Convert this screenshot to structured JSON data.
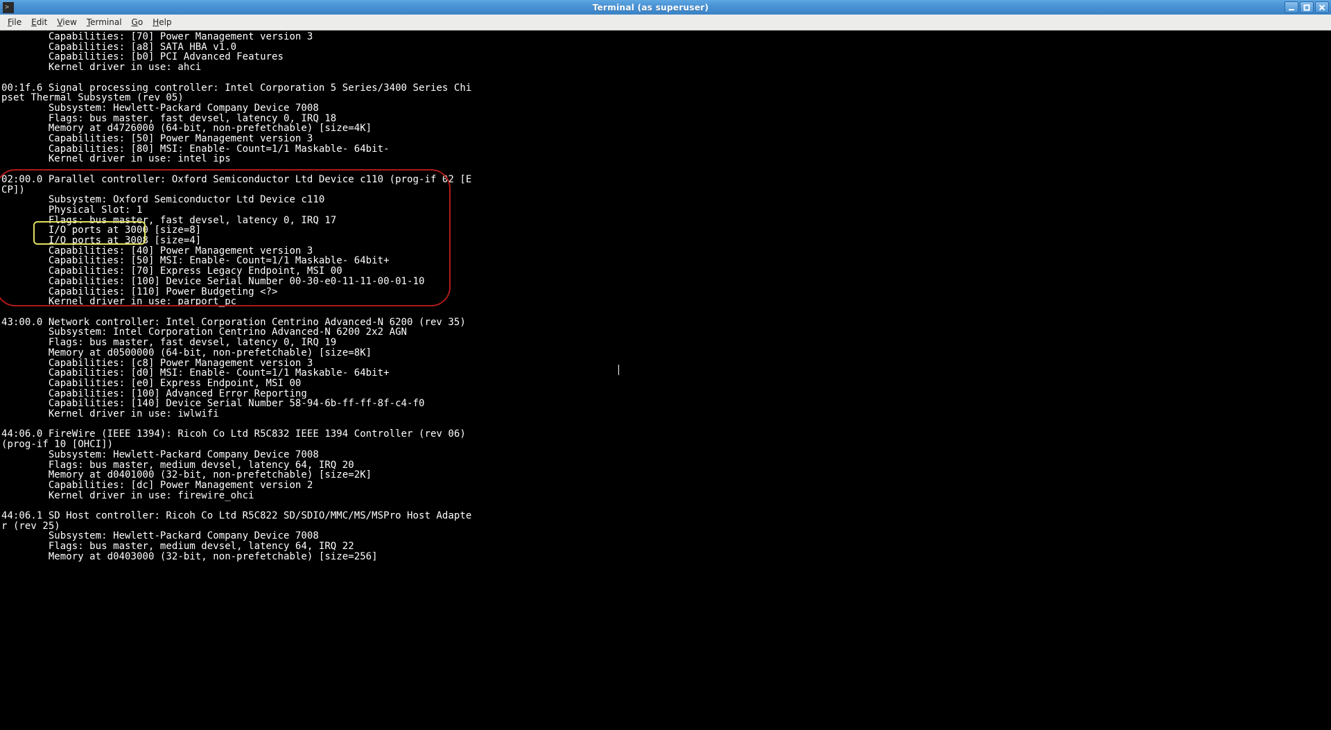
{
  "window": {
    "title": "Terminal (as superuser)"
  },
  "menu": {
    "file": "File",
    "edit": "Edit",
    "view": "View",
    "terminal": "Terminal",
    "go": "Go",
    "help": "Help"
  },
  "terminal": {
    "lines": [
      "        Capabilities: [70] Power Management version 3",
      "        Capabilities: [a8] SATA HBA v1.0",
      "        Capabilities: [b0] PCI Advanced Features",
      "        Kernel driver in use: ahci",
      "",
      "00:1f.6 Signal processing controller: Intel Corporation 5 Series/3400 Series Chi",
      "pset Thermal Subsystem (rev 05)",
      "        Subsystem: Hewlett-Packard Company Device 7008",
      "        Flags: bus master, fast devsel, latency 0, IRQ 18",
      "        Memory at d4726000 (64-bit, non-prefetchable) [size=4K]",
      "        Capabilities: [50] Power Management version 3",
      "        Capabilities: [80] MSI: Enable- Count=1/1 Maskable- 64bit-",
      "        Kernel driver in use: intel ips",
      "",
      "02:00.0 Parallel controller: Oxford Semiconductor Ltd Device c110 (prog-if 02 [E",
      "CP])",
      "        Subsystem: Oxford Semiconductor Ltd Device c110",
      "        Physical Slot: 1",
      "        Flags: bus master, fast devsel, latency 0, IRQ 17",
      "        I/O ports at 3000 [size=8]",
      "        I/O ports at 3008 [size=4]",
      "        Capabilities: [40] Power Management version 3",
      "        Capabilities: [50] MSI: Enable- Count=1/1 Maskable- 64bit+",
      "        Capabilities: [70] Express Legacy Endpoint, MSI 00",
      "        Capabilities: [100] Device Serial Number 00-30-e0-11-11-00-01-10",
      "        Capabilities: [110] Power Budgeting <?>",
      "        Kernel driver in use: parport_pc",
      "",
      "43:00.0 Network controller: Intel Corporation Centrino Advanced-N 6200 (rev 35)",
      "        Subsystem: Intel Corporation Centrino Advanced-N 6200 2x2 AGN",
      "        Flags: bus master, fast devsel, latency 0, IRQ 19",
      "        Memory at d0500000 (64-bit, non-prefetchable) [size=8K]",
      "        Capabilities: [c8] Power Management version 3",
      "        Capabilities: [d0] MSI: Enable- Count=1/1 Maskable- 64bit+",
      "        Capabilities: [e0] Express Endpoint, MSI 00",
      "        Capabilities: [100] Advanced Error Reporting",
      "        Capabilities: [140] Device Serial Number 58-94-6b-ff-ff-8f-c4-f0",
      "        Kernel driver in use: iwlwifi",
      "",
      "44:06.0 FireWire (IEEE 1394): Ricoh Co Ltd R5C832 IEEE 1394 Controller (rev 06) ",
      "(prog-if 10 [OHCI])",
      "        Subsystem: Hewlett-Packard Company Device 7008",
      "        Flags: bus master, medium devsel, latency 64, IRQ 20",
      "        Memory at d0401000 (32-bit, non-prefetchable) [size=2K]",
      "        Capabilities: [dc] Power Management version 2",
      "        Kernel driver in use: firewire_ohci",
      "",
      "44:06.1 SD Host controller: Ricoh Co Ltd R5C822 SD/SDIO/MMC/MS/MSPro Host Adapte",
      "r (rev 25)",
      "        Subsystem: Hewlett-Packard Company Device 7008",
      "        Flags: bus master, medium devsel, latency 64, IRQ 22",
      "        Memory at d0403000 (32-bit, non-prefetchable) [size=256]"
    ]
  }
}
